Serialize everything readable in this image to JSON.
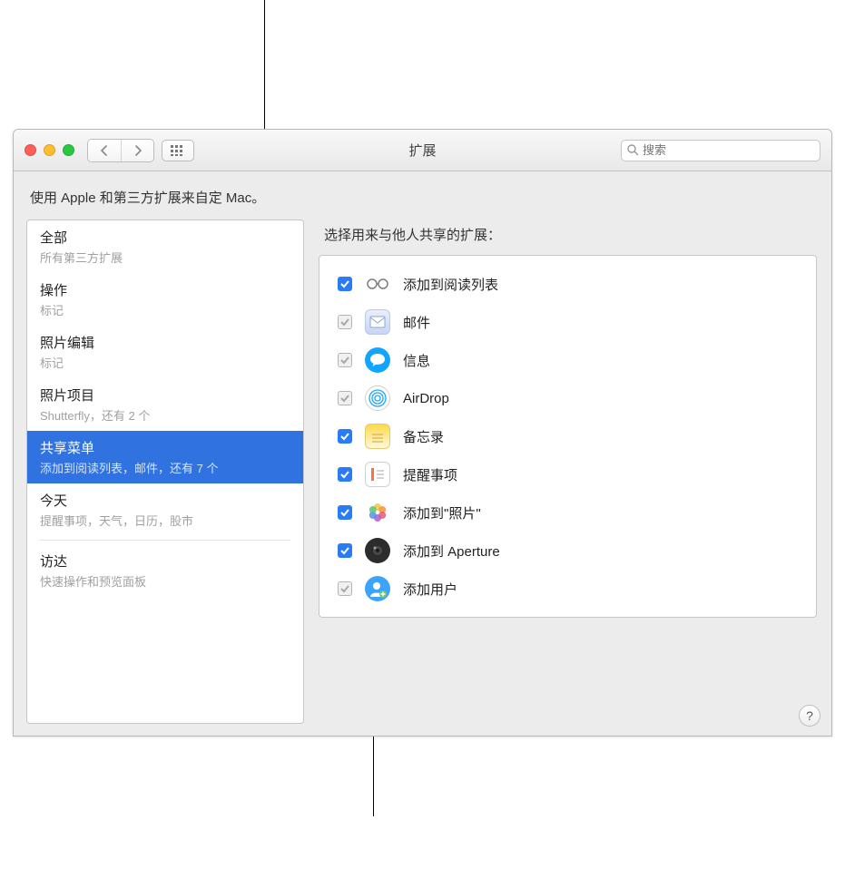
{
  "window": {
    "title": "扩展",
    "search_placeholder": "搜索"
  },
  "subhead": "使用 Apple 和第三方扩展来自定 Mac。",
  "sidebar": {
    "items": [
      {
        "title": "全部",
        "subtitle": "所有第三方扩展"
      },
      {
        "title": "操作",
        "subtitle": "标记"
      },
      {
        "title": "照片编辑",
        "subtitle": "标记"
      },
      {
        "title": "照片项目",
        "subtitle": "Shutterfly，还有 2 个"
      },
      {
        "title": "共享菜单",
        "subtitle": "添加到阅读列表，邮件，还有 7 个",
        "selected": true
      },
      {
        "title": "今天",
        "subtitle": "提醒事项，天气，日历，股市"
      },
      {
        "title": "访达",
        "subtitle": "快速操作和预览面板"
      }
    ]
  },
  "main": {
    "title": "选择用来与他人共享的扩展：",
    "extensions": [
      {
        "label": "添加到阅读列表",
        "checked": true,
        "enabled": true,
        "icon": "glasses"
      },
      {
        "label": "邮件",
        "checked": true,
        "enabled": false,
        "icon": "mail"
      },
      {
        "label": "信息",
        "checked": true,
        "enabled": false,
        "icon": "messages"
      },
      {
        "label": "AirDrop",
        "checked": true,
        "enabled": false,
        "icon": "airdrop"
      },
      {
        "label": "备忘录",
        "checked": true,
        "enabled": true,
        "icon": "notes"
      },
      {
        "label": "提醒事项",
        "checked": true,
        "enabled": true,
        "icon": "reminders"
      },
      {
        "label": "添加到\"照片\"",
        "checked": true,
        "enabled": true,
        "icon": "photos"
      },
      {
        "label": "添加到 Aperture",
        "checked": true,
        "enabled": true,
        "icon": "aperture"
      },
      {
        "label": "添加用户",
        "checked": true,
        "enabled": false,
        "icon": "adduser"
      }
    ]
  },
  "help_label": "?"
}
